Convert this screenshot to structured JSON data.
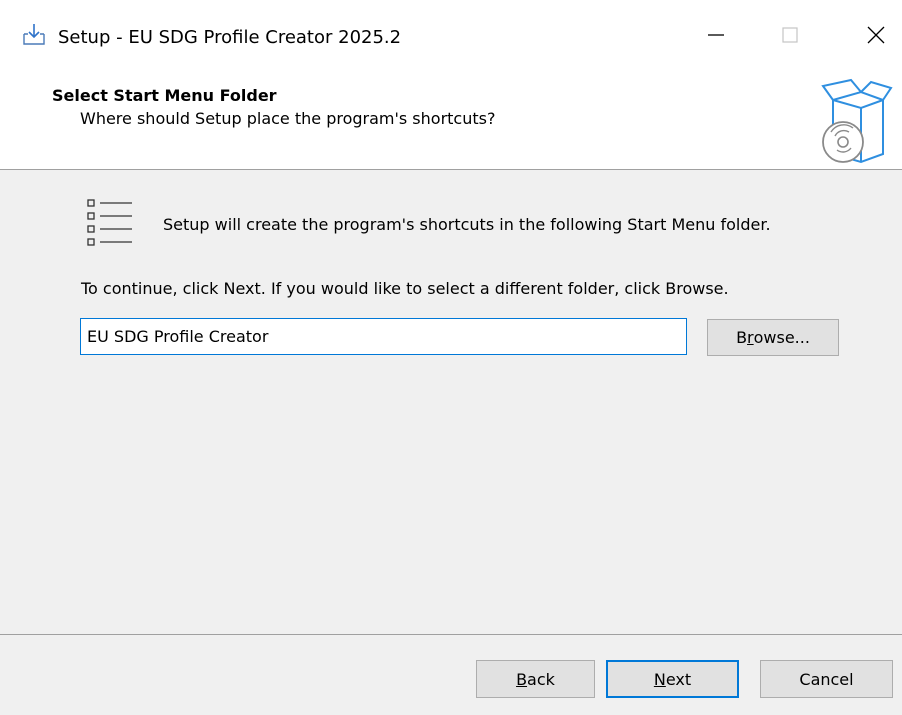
{
  "window": {
    "title": "Setup - EU SDG Profile Creator 2025.2",
    "icon": "installer-download-icon",
    "controls": {
      "minimize": "minimize-icon",
      "maximize": "maximize-icon",
      "close": "close-icon"
    }
  },
  "header": {
    "title": "Select Start Menu Folder",
    "subtitle": "Where should Setup place the program's shortcuts?",
    "icon": "setup-box-disc-icon"
  },
  "content": {
    "icon": "list-icon",
    "intro": "Setup will create the program's shortcuts in the following Start Menu folder.",
    "instruction": "To continue, click Next. If you would like to select a different folder, click Browse.",
    "folder_value": "EU SDG Profile Creator",
    "browse_pre": "B",
    "browse_mnemonic": "r",
    "browse_post": "owse..."
  },
  "footer": {
    "back_mnemonic": "B",
    "back_rest": "ack",
    "next_mnemonic": "N",
    "next_rest": "ext",
    "cancel": "Cancel"
  },
  "colors": {
    "accent": "#0078d7",
    "header_bg": "#ffffff",
    "body_bg": "#f0f0f0",
    "button_bg": "#e1e1e1"
  }
}
